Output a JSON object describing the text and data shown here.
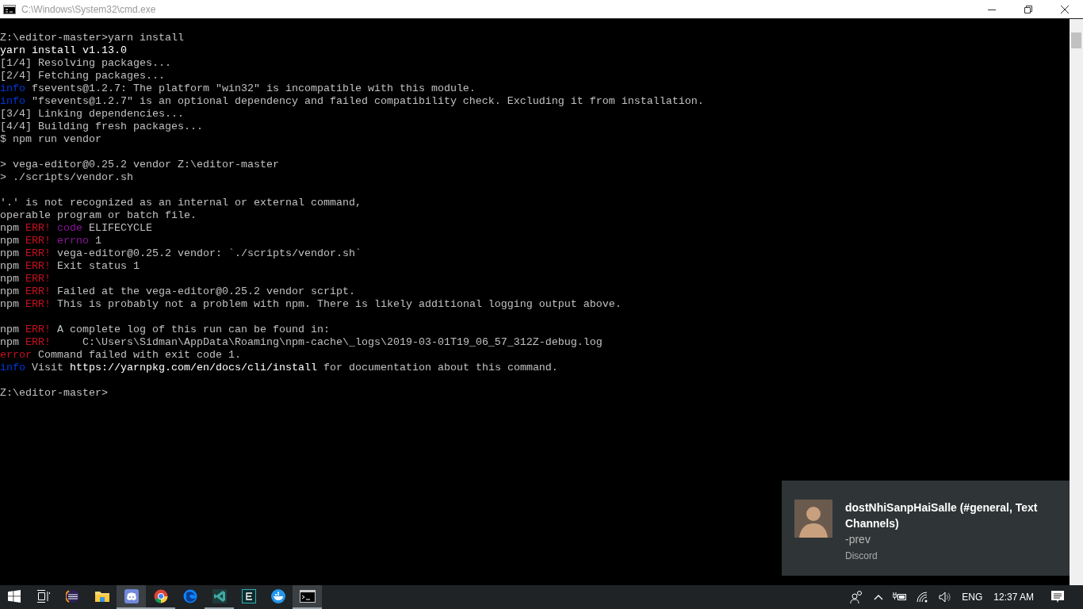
{
  "window": {
    "title": "C:\\Windows\\System32\\cmd.exe"
  },
  "terminal": {
    "lines": [
      {
        "kind": "text",
        "segments": [
          {
            "text": "Z:\\editor-master>yarn install",
            "kind": "plain"
          }
        ]
      },
      {
        "kind": "text",
        "segments": [
          {
            "text": "yarn install v1.13.0",
            "kind": "bright"
          }
        ]
      },
      {
        "kind": "text",
        "segments": [
          {
            "text": "[1/4] Resolving packages...",
            "kind": "plain"
          }
        ]
      },
      {
        "kind": "text",
        "segments": [
          {
            "text": "[2/4] Fetching packages...",
            "kind": "plain"
          }
        ]
      },
      {
        "kind": "text",
        "segments": [
          {
            "text": "info",
            "kind": "info"
          },
          {
            "text": " fsevents@1.2.7: The platform \"win32\" is incompatible with this module.",
            "kind": "plain"
          }
        ]
      },
      {
        "kind": "text",
        "segments": [
          {
            "text": "info",
            "kind": "info"
          },
          {
            "text": " \"fsevents@1.2.7\" is an optional dependency and failed compatibility check. Excluding it from installation.",
            "kind": "plain"
          }
        ]
      },
      {
        "kind": "text",
        "segments": [
          {
            "text": "[3/4] Linking dependencies...",
            "kind": "plain"
          }
        ]
      },
      {
        "kind": "text",
        "segments": [
          {
            "text": "[4/4] Building fresh packages...",
            "kind": "plain"
          }
        ]
      },
      {
        "kind": "text",
        "segments": [
          {
            "text": "$ npm run vendor",
            "kind": "plain"
          }
        ]
      },
      {
        "kind": "blank"
      },
      {
        "kind": "text",
        "segments": [
          {
            "text": "> vega-editor@0.25.2 vendor Z:\\editor-master",
            "kind": "plain"
          }
        ]
      },
      {
        "kind": "text",
        "segments": [
          {
            "text": "> ./scripts/vendor.sh",
            "kind": "plain"
          }
        ]
      },
      {
        "kind": "blank"
      },
      {
        "kind": "text",
        "segments": [
          {
            "text": "'.' is not recognized as an internal or external command,",
            "kind": "plain"
          }
        ]
      },
      {
        "kind": "text",
        "segments": [
          {
            "text": "operable program or batch file.",
            "kind": "plain"
          }
        ]
      },
      {
        "kind": "text",
        "segments": [
          {
            "text": "npm ",
            "kind": "plain"
          },
          {
            "text": "ERR!",
            "kind": "err"
          },
          {
            "text": " code",
            "kind": "key"
          },
          {
            "text": " ELIFECYCLE",
            "kind": "plain"
          }
        ]
      },
      {
        "kind": "text",
        "segments": [
          {
            "text": "npm ",
            "kind": "plain"
          },
          {
            "text": "ERR!",
            "kind": "err"
          },
          {
            "text": " errno",
            "kind": "key"
          },
          {
            "text": " 1",
            "kind": "plain"
          }
        ]
      },
      {
        "kind": "text",
        "segments": [
          {
            "text": "npm ",
            "kind": "plain"
          },
          {
            "text": "ERR!",
            "kind": "err"
          },
          {
            "text": " vega-editor@0.25.2 vendor: `./scripts/vendor.sh`",
            "kind": "plain"
          }
        ]
      },
      {
        "kind": "text",
        "segments": [
          {
            "text": "npm ",
            "kind": "plain"
          },
          {
            "text": "ERR!",
            "kind": "err"
          },
          {
            "text": " Exit status 1",
            "kind": "plain"
          }
        ]
      },
      {
        "kind": "text",
        "segments": [
          {
            "text": "npm ",
            "kind": "plain"
          },
          {
            "text": "ERR!",
            "kind": "err"
          }
        ]
      },
      {
        "kind": "text",
        "segments": [
          {
            "text": "npm ",
            "kind": "plain"
          },
          {
            "text": "ERR!",
            "kind": "err"
          },
          {
            "text": " Failed at the vega-editor@0.25.2 vendor script.",
            "kind": "plain"
          }
        ]
      },
      {
        "kind": "text",
        "segments": [
          {
            "text": "npm ",
            "kind": "plain"
          },
          {
            "text": "ERR!",
            "kind": "err"
          },
          {
            "text": " This is probably not a problem with npm. There is likely additional logging output above.",
            "kind": "plain"
          }
        ]
      },
      {
        "kind": "blank"
      },
      {
        "kind": "text",
        "segments": [
          {
            "text": "npm ",
            "kind": "plain"
          },
          {
            "text": "ERR!",
            "kind": "err"
          },
          {
            "text": " A complete log of this run can be found in:",
            "kind": "plain"
          }
        ]
      },
      {
        "kind": "text",
        "segments": [
          {
            "text": "npm ",
            "kind": "plain"
          },
          {
            "text": "ERR!",
            "kind": "err"
          },
          {
            "text": "     C:\\Users\\Sidman\\AppData\\Roaming\\npm-cache\\_logs\\2019-03-01T19_06_57_312Z-debug.log",
            "kind": "plain"
          }
        ]
      },
      {
        "kind": "text",
        "segments": [
          {
            "text": "error",
            "kind": "err"
          },
          {
            "text": " Command failed with exit code 1.",
            "kind": "plain"
          }
        ]
      },
      {
        "kind": "text",
        "segments": [
          {
            "text": "info",
            "kind": "info"
          },
          {
            "text": " Visit ",
            "kind": "plain"
          },
          {
            "text": "https://yarnpkg.com/en/docs/cli/install",
            "kind": "bright"
          },
          {
            "text": " for documentation about this command.",
            "kind": "plain"
          }
        ]
      },
      {
        "kind": "blank"
      },
      {
        "kind": "text",
        "segments": [
          {
            "text": "Z:\\editor-master>",
            "kind": "plain"
          }
        ]
      }
    ]
  },
  "notification": {
    "title": "dostNhiSanpHaiSalle (#general, Text Channels)",
    "message": "-prev",
    "app": "Discord"
  },
  "taskbar": {
    "apps": [
      {
        "kind": "eclipse",
        "running": false,
        "active": false
      },
      {
        "kind": "folder",
        "running": false,
        "active": false
      },
      {
        "kind": "discord",
        "running": true,
        "active": true
      },
      {
        "kind": "chrome",
        "running": true,
        "active": false
      },
      {
        "kind": "firefox",
        "running": false,
        "active": false
      },
      {
        "kind": "vscode",
        "running": true,
        "active": false
      },
      {
        "kind": "editor",
        "running": false,
        "active": false
      },
      {
        "kind": "docker",
        "running": false,
        "active": false
      },
      {
        "kind": "terminal",
        "running": true,
        "active": true
      }
    ],
    "language": "ENG",
    "time": "12:37 AM"
  }
}
